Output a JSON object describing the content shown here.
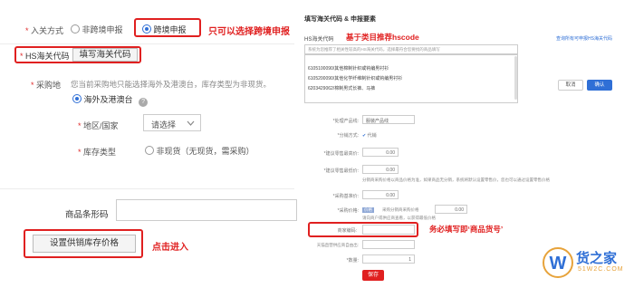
{
  "left": {
    "entry_method_label": "入关方式",
    "radio_options": [
      "非跨境申报",
      "跨境申报"
    ],
    "cross_border_hint": "只可以选择跨境申报",
    "hs_label": "HS海关代码",
    "hs_button": "填写海关代码",
    "purchase_label": "采购地",
    "purchase_desc": "您当前采购地只能选择海外及港澳台，库存类型为非现货。",
    "overseas_option": "海外及港澳台",
    "help_icon": "?",
    "region_label": "地区/国家",
    "region_placeholder": "请选择",
    "stock_type_label": "库存类型",
    "stock_type_option": "非现货（无现货，需采购）",
    "barcode_label": "商品条形码",
    "supply_price_button": "设置供销库存价格",
    "click_enter": "点击进入"
  },
  "right": {
    "dialog_title": "填写海关代码 & 申报要素",
    "hs_label": "HS海关代码",
    "recommend_note": "基于类目推荐hscode",
    "query_link": "查询所有可申报HS海关代码",
    "search_placeholder": "系统为您推荐了相关性较高的HS海关代码，选择最符合您要找的商品填写",
    "options": [
      "6105100090/其他棉制针织或钩编男衬衫",
      "6105200090/其他化学纤维制针织或钩编男衬衫",
      "6203429062/棉制男式长裤、马裤"
    ],
    "cancel": "取消",
    "confirm": "确认",
    "form_rows": [
      {
        "label": "*处理产品线:",
        "value": "服装产品线"
      },
      {
        "label": "*分销方式:",
        "value": "代销"
      },
      {
        "label": "*建议零售最高价:",
        "value": "0.00"
      },
      {
        "label": "*建议零售最低价:",
        "value": "0.00"
      },
      {
        "label": "*采购基准价:",
        "value": "0.00"
      },
      {
        "label": "*采购价格:",
        "value": "0.00"
      }
    ],
    "price_note": "分销商采购价格以商品价格为准，如果商品无分销，系统将默认设置零售价，您也可以通过设置零售价格",
    "purchase_price_hint": "采购分销商采购价格",
    "purchase_note": "请向商户或供应商查看，以获得最低价格",
    "goods_no_label": "商家编码:",
    "goods_no_hint": "务必填写即‘商品货号’",
    "weight_label": "天猫直营供应商自由出:",
    "qty_label": "*数量:",
    "qty_value": "1",
    "save": "保存"
  },
  "watermark": {
    "letter": "W",
    "name": "货之家",
    "domain": "51W2C.COM"
  }
}
